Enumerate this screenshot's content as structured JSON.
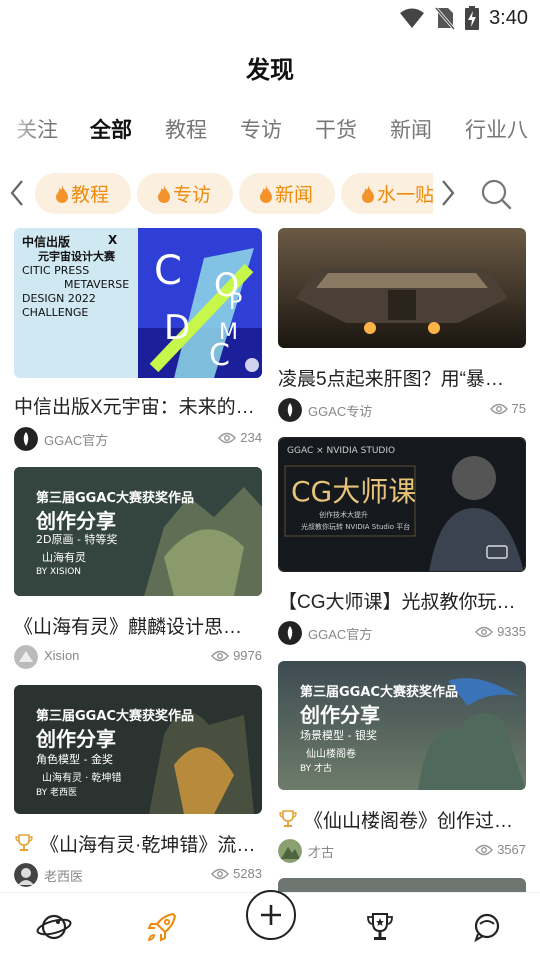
{
  "status": {
    "time": "3:40"
  },
  "page_title": "发现",
  "tabs": [
    "关注",
    "全部",
    "教程",
    "专访",
    "干货",
    "新闻",
    "行业八"
  ],
  "active_tab": "全部",
  "tags": [
    "教程",
    "专访",
    "新闻",
    "水一贴"
  ],
  "cards": [
    {
      "title": "中信出版X元宇宙：未来的…",
      "author": "GGAC官方",
      "views": "234",
      "thumb": {
        "l1": "中信出版",
        "x": "X",
        "l2": "元宇宙设计大赛",
        "l3": "CITIC PRESS",
        "l4": "METAVERSE",
        "l5": "DESIGN 2022",
        "l6": "CHALLENGE",
        "letters": [
          "C",
          "O",
          "P",
          "D",
          "M",
          "C"
        ]
      }
    },
    {
      "title": "凌晨5点起来肝图？用“暴…",
      "author": "GGAC专访",
      "views": "75"
    },
    {
      "title": "《山海有灵》麒麟设计思…",
      "author": "Xision",
      "views": "9976",
      "thumb": {
        "l1": "第三届GGAC大赛获奖作品",
        "l2": "创作分享",
        "l3": "2D原画 - 特等奖",
        "l4": "山海有灵",
        "l5": "BY XISION"
      }
    },
    {
      "title": "【CG大师课】光叔教你玩…",
      "author": "GGAC官方",
      "views": "9335",
      "thumb": {
        "l1": "GGAC × NVIDIA STUDIO",
        "l2": "CG大师课",
        "l3": "创作技术大提升",
        "l4": "光叔教你玩转 NVIDIA Studio 平台"
      }
    },
    {
      "title": "《山海有灵·乾坤错》流…",
      "author": "老西医",
      "views": "5283",
      "thumb": {
        "l1": "第三届GGAC大赛获奖作品",
        "l2": "创作分享",
        "l3": "角色模型 - 金奖",
        "l4": "山海有灵 · 乾坤错",
        "l5": "BY 老西医"
      }
    },
    {
      "title": "《仙山楼阁卷》创作过…",
      "author": "才古",
      "views": "3567",
      "thumb": {
        "l1": "第三届GGAC大赛获奖作品",
        "l2": "创作分享",
        "l3": "场景模型 - 银奖",
        "l4": "仙山楼阁卷",
        "l5": "BY 才古"
      }
    }
  ],
  "colors": {
    "accent": "#ee8a0c",
    "tag_bg": "#fbf0df",
    "trophy": "#e5a33a"
  },
  "nav": [
    "planet-icon",
    "rocket-icon",
    "add-icon",
    "trophy-icon",
    "chat-icon"
  ]
}
